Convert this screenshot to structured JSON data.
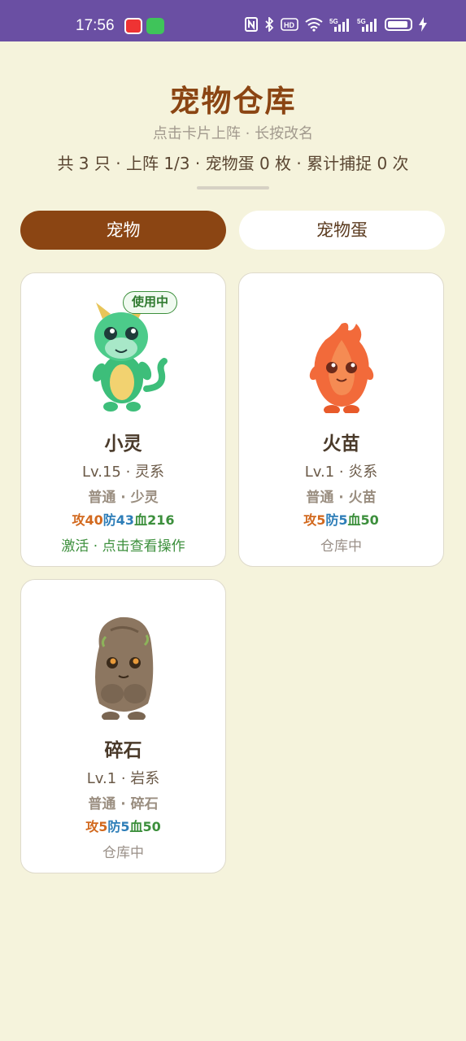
{
  "status_bar": {
    "time": "17:56",
    "apps": [
      "byd-app-icon",
      "messages-app-icon"
    ],
    "icons": [
      "nfc-icon",
      "bluetooth-icon",
      "hd-icon",
      "wifi-icon",
      "5g-signal-icon",
      "5g-signal-icon",
      "battery-icon",
      "charging-icon"
    ]
  },
  "header": {
    "title": "宠物仓库",
    "subtitle": "点击卡片上阵 · 长按改名",
    "summary": "共 3 只 · 上阵 1/3 · 宠物蛋 0 枚 · 累计捕捉 0 次"
  },
  "tabs": [
    {
      "label": "宠物",
      "active": true
    },
    {
      "label": "宠物蛋",
      "active": false
    }
  ],
  "pets": [
    {
      "name": "小灵",
      "level": "Lv.15 · 灵系",
      "kind": "普通 · 少灵",
      "atk": "攻40",
      "def": "防43",
      "hp": "血216",
      "status": "激活 · 点击查看操作",
      "badge": "使用中",
      "icon": "green-dragon-icon"
    },
    {
      "name": "火苗",
      "level": "Lv.1 · 炎系",
      "kind": "普通 · 火苗",
      "atk": "攻5",
      "def": "防5",
      "hp": "血50",
      "status": "仓库中",
      "icon": "fire-sprite-icon"
    },
    {
      "name": "碎石",
      "level": "Lv.1 · 岩系",
      "kind": "普通 · 碎石",
      "atk": "攻5",
      "def": "防5",
      "hp": "血50",
      "status": "仓库中",
      "icon": "rock-golem-icon"
    }
  ],
  "colors": {
    "background": "#F5F3DC",
    "accent": "#8B4513",
    "status_bar": "#6A4FA3",
    "active_green": "#3C8F3C",
    "attack": "#D2691E",
    "defense": "#2E7EB8"
  }
}
